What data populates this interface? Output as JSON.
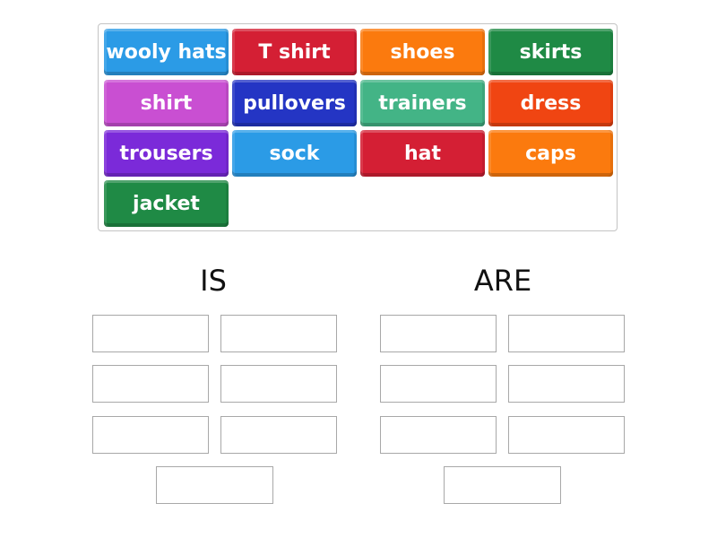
{
  "bank": {
    "tiles": [
      {
        "label": "wooly hats",
        "color": "#2b9be6"
      },
      {
        "label": "T shirt",
        "color": "#d41f34"
      },
      {
        "label": "shoes",
        "color": "#fb7a0e"
      },
      {
        "label": "skirts",
        "color": "#1f8a45"
      },
      {
        "label": "shirt",
        "color": "#c94fd2"
      },
      {
        "label": "pullovers",
        "color": "#2435c4"
      },
      {
        "label": "trainers",
        "color": "#43b486"
      },
      {
        "label": "dress",
        "color": "#f04512"
      },
      {
        "label": "trousers",
        "color": "#7b2ad9"
      },
      {
        "label": "sock",
        "color": "#2b9be6"
      },
      {
        "label": "hat",
        "color": "#d41f34"
      },
      {
        "label": "caps",
        "color": "#fb7a0e"
      },
      {
        "label": "jacket",
        "color": "#1f8a45"
      }
    ]
  },
  "groups": [
    {
      "title": "IS",
      "slot_count": 7
    },
    {
      "title": "ARE",
      "slot_count": 7
    }
  ]
}
